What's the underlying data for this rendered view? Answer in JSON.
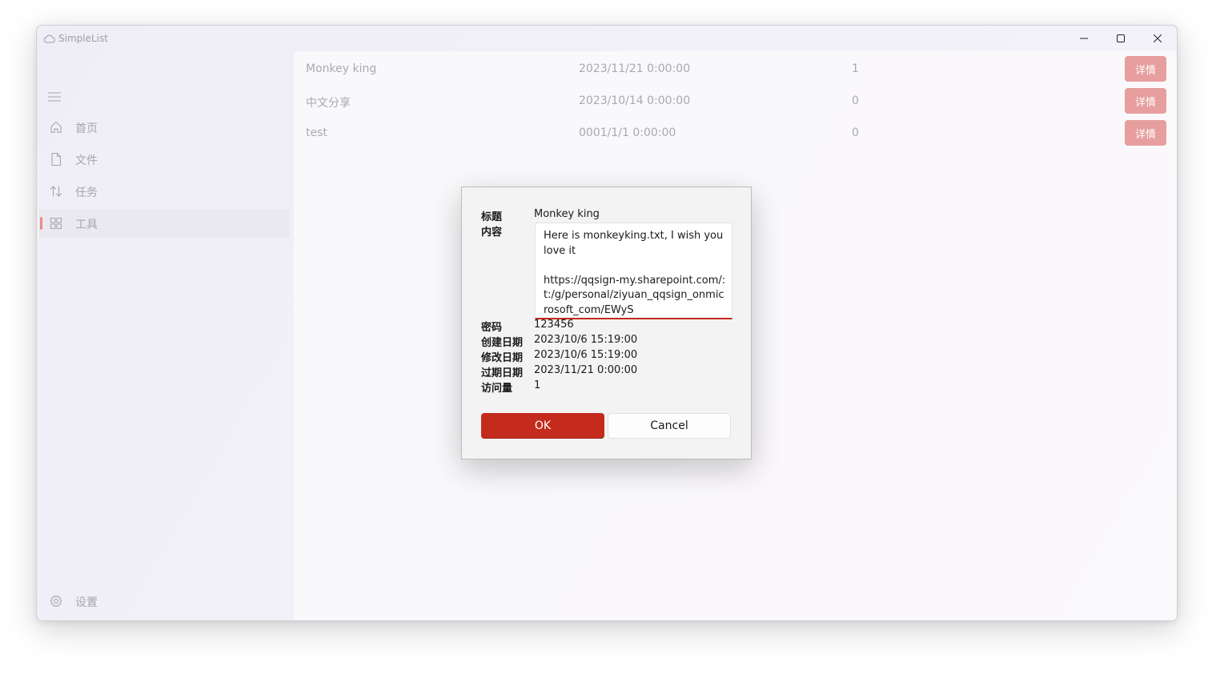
{
  "app": {
    "title": "SimpleList"
  },
  "caption": {
    "minimize_icon": "minimize-icon",
    "maximize_icon": "maximize-icon",
    "close_icon": "close-icon"
  },
  "sidebar": {
    "menu_icon": "hamburger-icon",
    "items": [
      {
        "label": "首页",
        "icon": "home-icon"
      },
      {
        "label": "文件",
        "icon": "file-icon"
      },
      {
        "label": "任务",
        "icon": "transfer-icon"
      },
      {
        "label": "工具",
        "icon": "grid-icon",
        "active": true
      }
    ],
    "settings": {
      "label": "设置",
      "icon": "gear-icon"
    }
  },
  "list": {
    "rows": [
      {
        "title": "Monkey king",
        "date": "2023/11/21 0:00:00",
        "count": "1",
        "action": "详情"
      },
      {
        "title": "中文分享",
        "date": "2023/10/14 0:00:00",
        "count": "0",
        "action": "详情"
      },
      {
        "title": "test",
        "date": "0001/1/1 0:00:00",
        "count": "0",
        "action": "详情"
      }
    ]
  },
  "dialog": {
    "title_label": "标题",
    "title_value": "Monkey king",
    "content_label": "内容",
    "content_value": "Here is monkeyking.txt, I wish you love it\n\nhttps://qqsign-my.sharepoint.com/:t:/g/personal/ziyuan_qqsign_onmicrosoft_com/EWyS",
    "password_label": "密码",
    "password_value": "123456",
    "created_label": "创建日期",
    "created_value": "2023/10/6 15:19:00",
    "modified_label": "修改日期",
    "modified_value": "2023/10/6 15:19:00",
    "expire_label": "过期日期",
    "expire_value": "2023/11/21 0:00:00",
    "views_label": "访问量",
    "views_value": "1",
    "ok_label": "OK",
    "cancel_label": "Cancel"
  },
  "colors": {
    "accent": "#c42b1c",
    "accent_disabled": "#e79e9e",
    "indicator": "#ea8a8a"
  }
}
